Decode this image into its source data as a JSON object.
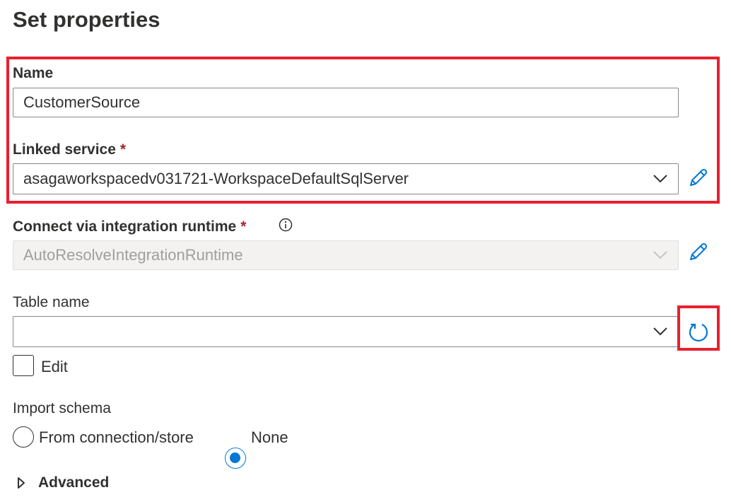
{
  "header": {
    "title": "Set properties"
  },
  "name": {
    "label": "Name",
    "value": "CustomerSource"
  },
  "linked_service": {
    "label": "Linked service",
    "required_mark": "*",
    "value": "asagaworkspacedv031721-WorkspaceDefaultSqlServer"
  },
  "integration_runtime": {
    "label": "Connect via integration runtime",
    "required_mark": "*",
    "value": "AutoResolveIntegrationRuntime"
  },
  "table_name": {
    "label": "Table name",
    "value": "",
    "edit_label": "Edit",
    "edit_checked": false
  },
  "import_schema": {
    "label": "Import schema",
    "options": [
      {
        "label": "From connection/store",
        "selected": false
      },
      {
        "label": "None",
        "selected": true
      }
    ]
  },
  "advanced": {
    "label": "Advanced"
  },
  "colors": {
    "accent": "#0078d4",
    "highlight": "#e8202f",
    "required": "#a4262c"
  },
  "icons": [
    "chevron-down-icon",
    "pencil-edit-icon",
    "info-icon",
    "refresh-icon",
    "triangle-right-icon"
  ]
}
